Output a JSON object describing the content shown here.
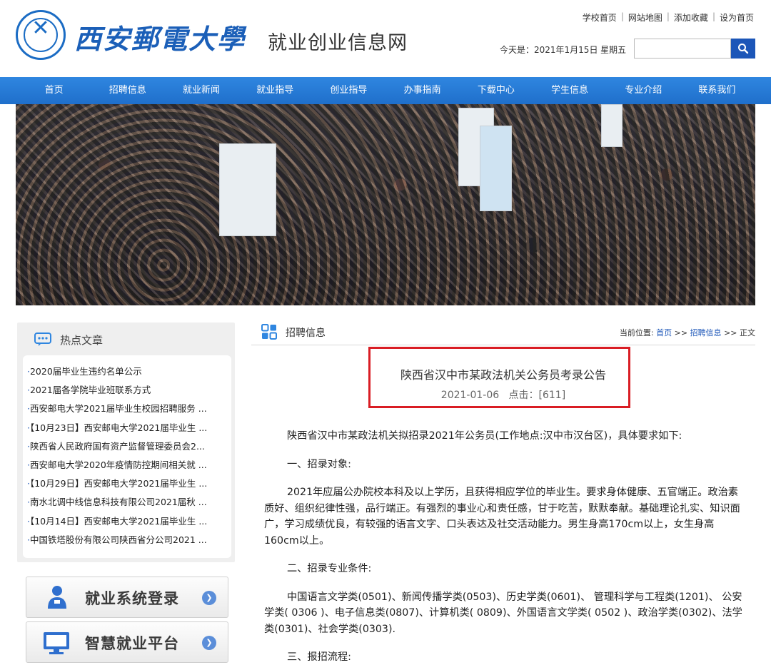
{
  "header": {
    "school_name": "西安郵電大學",
    "site_name": "就业创业信息网",
    "top_links": [
      "学校首页",
      "网站地图",
      "添加收藏",
      "设为首页"
    ],
    "date_text": "今天是：2021年1月15日",
    "weekday": "星期五",
    "search_placeholder": ""
  },
  "nav": {
    "items": [
      "首页",
      "招聘信息",
      "就业新闻",
      "就业指导",
      "创业指导",
      "办事指南",
      "下载中心",
      "学生信息",
      "专业介绍",
      "联系我们"
    ]
  },
  "sidebar": {
    "hot_title": "热点文章",
    "hot_items": [
      "2020届毕业生违约名单公示",
      "2021届各学院毕业班联系方式",
      "西安邮电大学2021届毕业生校园招聘服务 ...",
      "【10月23日】西安邮电大学2021届毕业生 ...",
      "陕西省人民政府国有资产监督管理委员会2...",
      "西安邮电大学2020年疫情防控期间相关就 ...",
      "【10月29日】西安邮电大学2021届毕业生 ...",
      "南水北调中线信息科技有限公司2021届秋 ...",
      "【10月14日】西安邮电大学2021届毕业生 ...",
      "中国铁塔股份有限公司陕西省分公司2021 ..."
    ],
    "buttons": [
      "就业系统登录",
      "智慧就业平台"
    ]
  },
  "main": {
    "section_title": "招聘信息",
    "breadcrumb": {
      "prefix": "当前位置:",
      "home": "首页",
      "sep1": ">>",
      "section": "招聘信息",
      "sep2": ">>",
      "current": "正文"
    },
    "article": {
      "title": "陕西省汉中市某政法机关公务员考录公告",
      "date": "2021-01-06",
      "clicks_label": "点击：[611]",
      "paragraphs": [
        "陕西省汉中市某政法机关拟招录2021年公务员(工作地点:汉中市汉台区)，具体要求如下:",
        "一、招录对象:",
        "2021年应届公办院校本科及以上学历，且获得相应学位的毕业生。要求身体健康、五官端正。政治素质好、组织纪律性强，品行端正。有强烈的事业心和责任感，甘于吃苦，默默奉献。基础理论扎实、知识面广，学习成绩优良，有较强的语言文字、口头表达及社交活动能力。男生身高170cm以上，女生身高160cm以上。",
        "二、招录专业条件:",
        "中国语言文学类(0501)、新闻传播学类(0503)、历史学类(0601)、 管理科学与工程类(1201)、 公安学类( 0306 )、电子信息类(0807)、计算机类( 0809)、外国语言文学类( 0502 )、政治学类(0302)、法学类(0301)、社会学类(0303).",
        "三、报招流程:"
      ]
    }
  },
  "colors": {
    "brand_blue": "#1c56b8",
    "nav_blue": "#2677d6",
    "highlight_red": "#d91d24"
  },
  "icons": [
    "search-icon",
    "chat-icon",
    "grid-icon",
    "user-icon",
    "monitor-icon",
    "arrow-right-icon"
  ]
}
